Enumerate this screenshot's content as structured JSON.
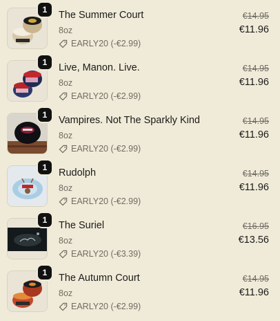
{
  "cart": {
    "items": [
      {
        "qty": "1",
        "title": "The Summer Court",
        "variant": "8oz",
        "discount": "EARLY20 (-€2.99)",
        "compare_price": "€14.95",
        "price": "€11.96"
      },
      {
        "qty": "1",
        "title": "Live, Manon. Live.",
        "variant": "8oz",
        "discount": "EARLY20 (-€2.99)",
        "compare_price": "€14.95",
        "price": "€11.96"
      },
      {
        "qty": "1",
        "title": "Vampires. Not The Sparkly Kind",
        "variant": "8oz",
        "discount": "EARLY20 (-€2.99)",
        "compare_price": "€14.95",
        "price": "€11.96"
      },
      {
        "qty": "1",
        "title": "Rudolph",
        "variant": "8oz",
        "discount": "EARLY20 (-€2.99)",
        "compare_price": "€14.95",
        "price": "€11.96"
      },
      {
        "qty": "1",
        "title": "The Suriel",
        "variant": "8oz",
        "discount": "EARLY20 (-€3.39)",
        "compare_price": "€16.95",
        "price": "€13.56"
      },
      {
        "qty": "1",
        "title": "The Autumn Court",
        "variant": "8oz",
        "discount": "EARLY20 (-€2.99)",
        "compare_price": "€14.95",
        "price": "€11.96"
      }
    ]
  },
  "colors": {
    "background": "#f0ebd8",
    "badge": "#111111",
    "muted_text": "#6f6c63"
  },
  "icons": {
    "discount": "tag-icon"
  }
}
